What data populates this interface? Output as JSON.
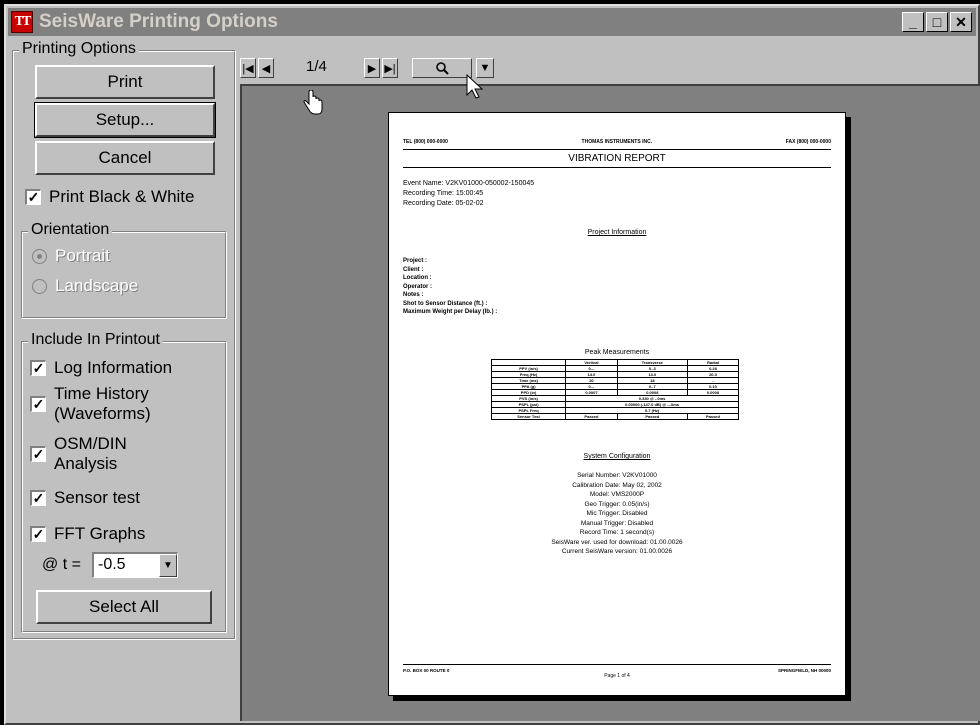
{
  "window": {
    "title": "SeisWare Printing Options",
    "icon_text": "TT",
    "minimize": "_",
    "maximize": "□",
    "close": "✕"
  },
  "options": {
    "group_label": "Printing Options",
    "print_label": "Print",
    "setup_label": "Setup...",
    "cancel_label": "Cancel",
    "bw_label": "Print Black & White",
    "bw_checked": true
  },
  "orientation": {
    "label": "Orientation",
    "portrait": "Portrait",
    "landscape": "Landscape",
    "selected": "portrait"
  },
  "include": {
    "label": "Include In Printout",
    "items": [
      {
        "label": "Log Information",
        "checked": true
      },
      {
        "label": "Time History\n(Waveforms)",
        "checked": true
      },
      {
        "label": "OSM/DIN\nAnalysis",
        "checked": true
      },
      {
        "label": "Sensor test",
        "checked": true
      },
      {
        "label": "FFT Graphs",
        "checked": true
      }
    ],
    "t_label": "@ t =",
    "t_value": "-0.5",
    "select_all": "Select All"
  },
  "toolbar": {
    "page": "1/4"
  },
  "report": {
    "header_left": "TEL (800) 000-0000",
    "header_center": "THOMAS INSTRUMENTS INC.",
    "header_right": "FAX (800) 000-0000",
    "title": "VIBRATION REPORT",
    "event_lines": [
      "Event Name: V2KV01000-050002-150045",
      "Recording Time: 15:00:45",
      "Recording Date: 05-02-02"
    ],
    "project_title": "Project Information",
    "project_lines": [
      "Project :",
      "Client :",
      "Location :",
      "Operator :",
      "Notes :",
      "Shot to Sensor Distance (ft.) :",
      "Maximum Weight per Delay (lb.) :"
    ],
    "peak_title": "Peak Measurements",
    "peak_header": [
      "",
      "Vertical",
      "Transverse",
      "Radial"
    ],
    "peak_rows": [
      [
        "PPV (in/s)",
        "0.--",
        "0.-3",
        "0.28"
      ],
      [
        "Freq (Hz)",
        "14.0",
        "13.0",
        "20.3"
      ],
      [
        "Time (ms)",
        "20",
        "18",
        "-"
      ],
      [
        "PPA (g)",
        "0.--",
        "0.-7",
        "0.10"
      ],
      [
        "PPD (in)",
        "0.0007",
        "0.0008",
        "0.0008"
      ]
    ],
    "peak_wide_rows": [
      [
        "PVS (in/s)",
        "0.330 @ -.0ms"
      ],
      [
        "PSPL (psi)",
        "0.00000 (-147.0 dB) @ --.0ms"
      ],
      [
        "PSPL Freq",
        "0.7 (Hz)"
      ]
    ],
    "sensor_row": [
      "Sensor Test",
      "Passed",
      "Passed",
      "Passed"
    ],
    "system_title": "System Configuration",
    "system_lines": [
      "Serial Number: V2KV01000",
      "Calibration Date: May 02, 2002",
      "Model: VMS2000P",
      "Geo Trigger: 0.05(in/s)",
      "Mic Trigger: Disabled",
      "Manual Trigger: Disabled",
      "Record Time: 1 second(s)",
      "SeisWare ver. used for download: 01.00.0026",
      "Current SeisWare version: 01.00.0026"
    ],
    "footer_left": "P.O. BOX 00 ROUTE 0",
    "footer_center": "Page 1 of 4",
    "footer_right": "SPRINGFIELD, NH 00000"
  }
}
